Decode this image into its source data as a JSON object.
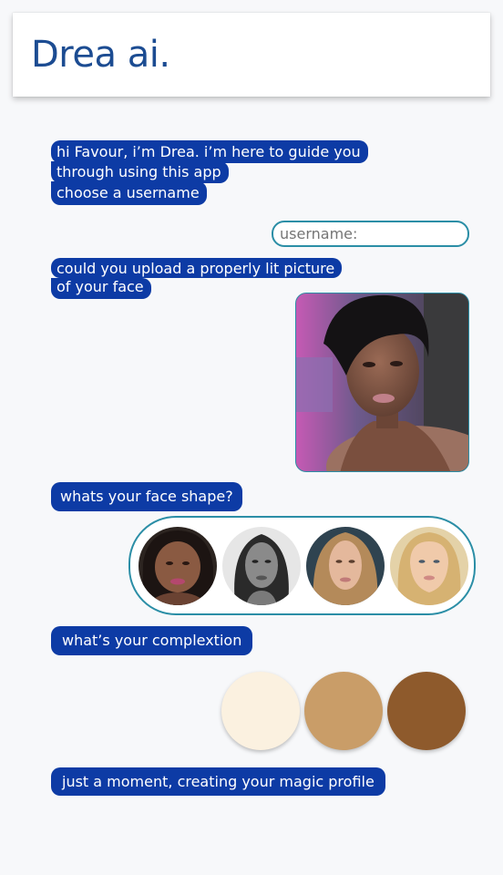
{
  "header": {
    "title": "Drea ai."
  },
  "chat": {
    "greeting_lines": [
      "hi Favour, i’m Drea. i’m here to guide you",
      "through using this app",
      "choose a username"
    ],
    "username_placeholder": "username:",
    "upload_lines": [
      "could you upload a properly lit picture",
      "of your face"
    ],
    "face_shape_question": "whats your face shape?",
    "complexion_question": "what’s your complextion",
    "final_message": "just a moment, creating your magic profile"
  },
  "colors": {
    "bubble": "#0d3ba5",
    "accent": "#2b8ea6",
    "title": "#1c4c92",
    "complexions": [
      "#fbf1e0",
      "#c99d68",
      "#8e5a2c"
    ]
  },
  "face_shape_options": [
    {
      "icon": "round-face-photo"
    },
    {
      "icon": "oval-face-photo"
    },
    {
      "icon": "long-face-photo"
    },
    {
      "icon": "heart-face-photo"
    }
  ]
}
